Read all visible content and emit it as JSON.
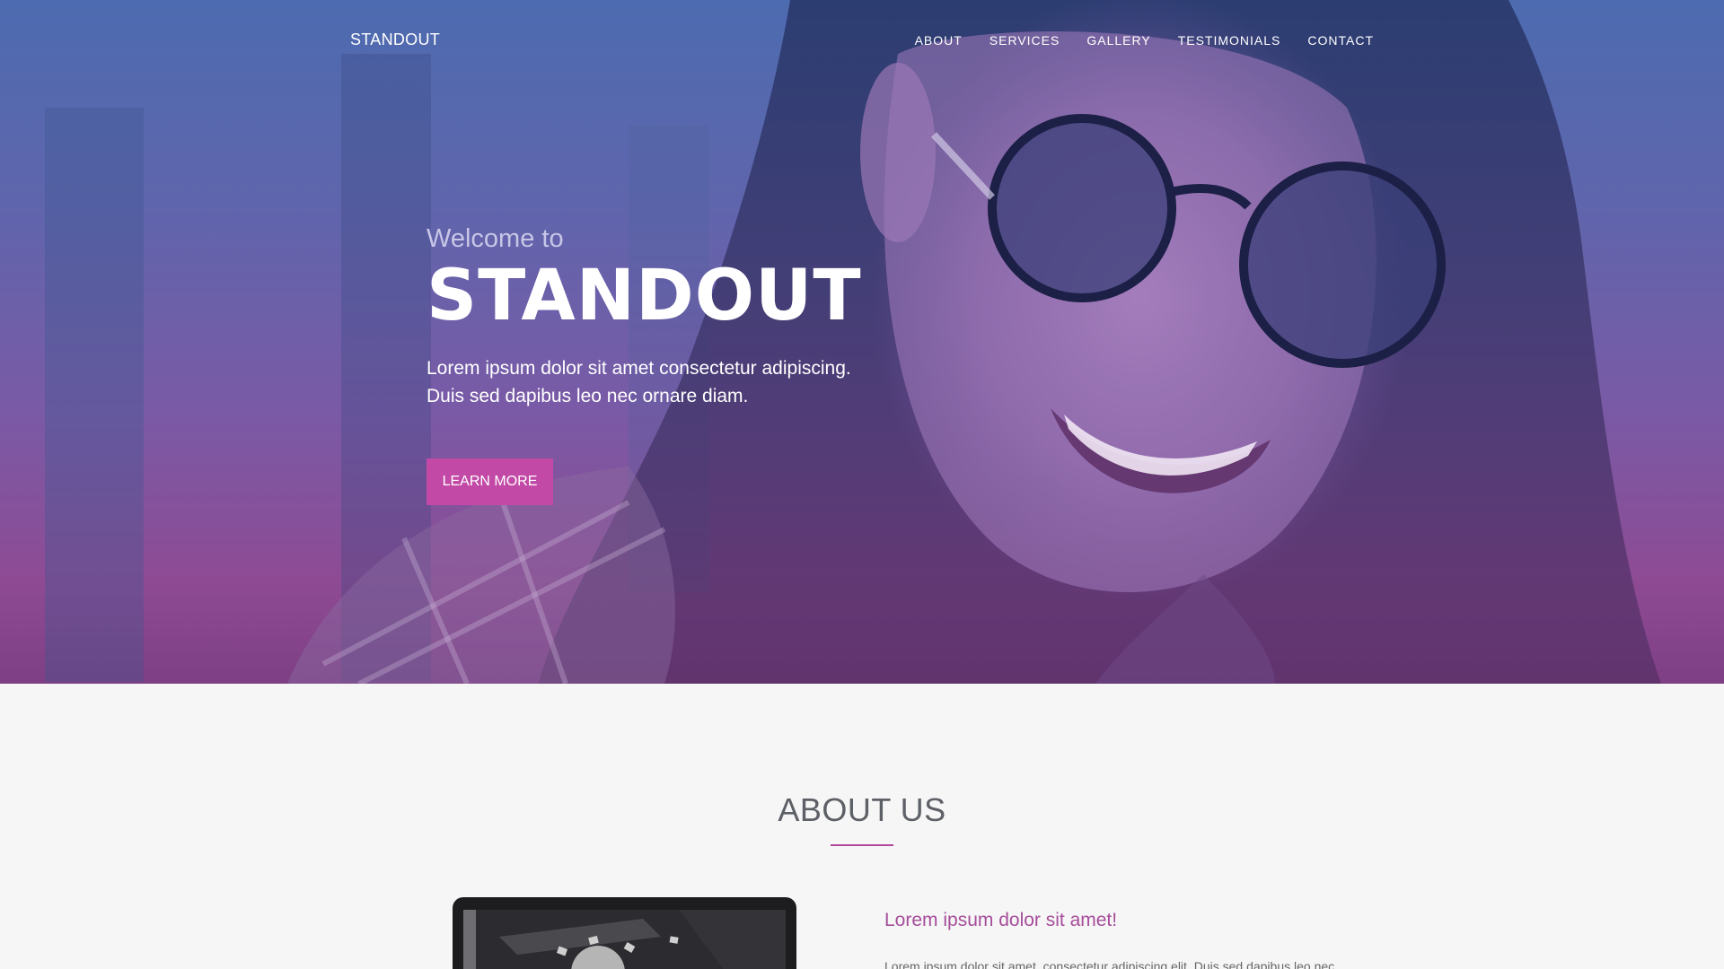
{
  "navbar": {
    "brand": "STANDOUT",
    "items": [
      {
        "label": "ABOUT"
      },
      {
        "label": "SERVICES"
      },
      {
        "label": "GALLERY"
      },
      {
        "label": "TESTIMONIALS"
      },
      {
        "label": "CONTACT"
      }
    ]
  },
  "hero": {
    "welcome": "Welcome to",
    "title": "STANDOUT",
    "desc_line1": "Lorem ipsum dolor sit amet consectetur adipiscing.",
    "desc_line2": "Duis sed dapibus leo nec ornare diam.",
    "button_label": "LEARN MORE"
  },
  "about": {
    "title": "ABOUT US",
    "subtitle": "Lorem ipsum dolor sit amet!",
    "text": "Lorem ipsum dolor sit amet, consectetur adipiscing elit. Duis sed dapibus leo nec"
  },
  "colors": {
    "accent": "#c24aa6",
    "heading_accent": "#a64d9a"
  }
}
